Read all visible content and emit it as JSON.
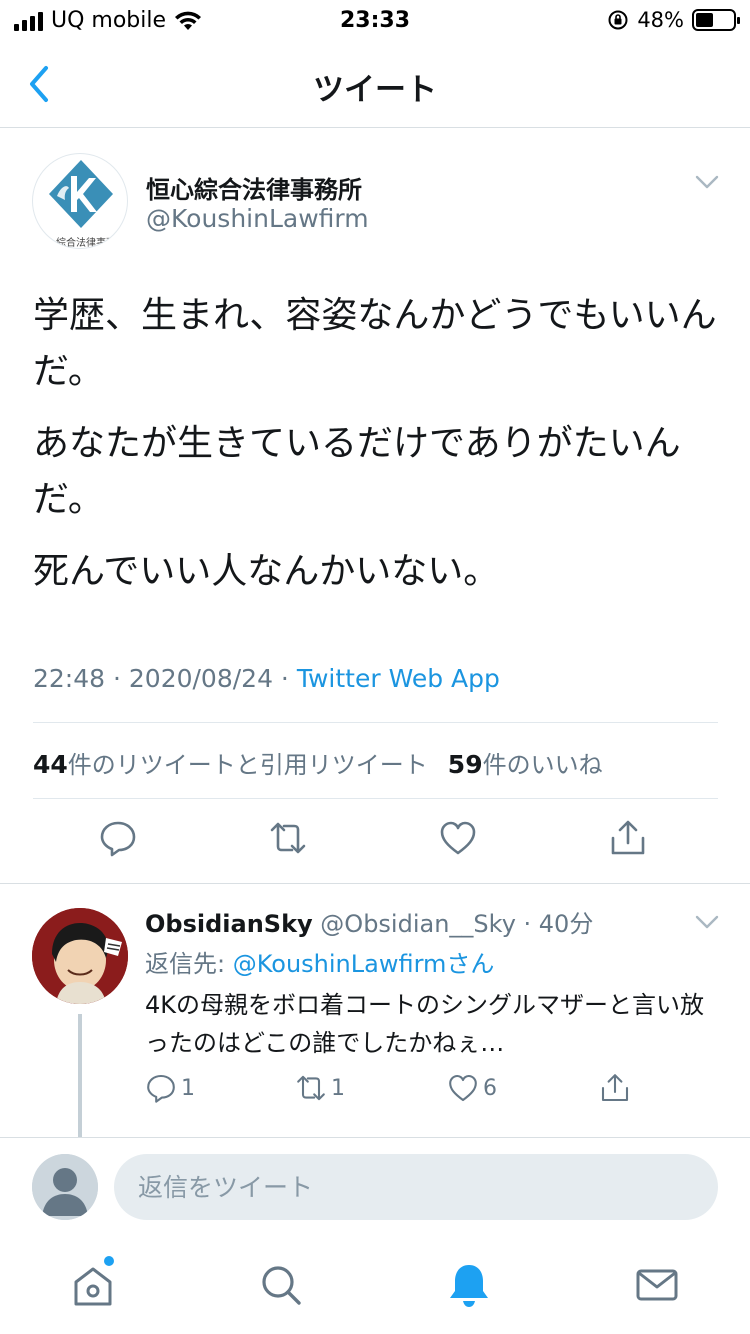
{
  "status_bar": {
    "carrier": "UQ mobile",
    "time": "23:33",
    "battery": "48%",
    "battery_level": 0.48
  },
  "nav": {
    "title": "ツイート"
  },
  "tweet": {
    "author_name": "恒心綜合法律事務所",
    "author_handle": "@KoushinLawfirm",
    "avatar_caption": "恒心綜合法律事務所",
    "paragraphs": [
      "学歴、生まれ、容姿なんかどうでもいいんだ。",
      "あなたが生きているだけでありがたいんだ。",
      "死んでいい人なんかいない。"
    ],
    "timestamp": "22:48 · 2020/08/24 · ",
    "source": "Twitter Web App",
    "retweet_count": "44",
    "retweet_label": "件のリツイートと引用リツイート",
    "like_count": "59",
    "like_label": "件のいいね"
  },
  "reply": {
    "name": "ObsidianSky",
    "meta": " @Obsidian__Sky · 40分",
    "reply_to_prefix": "返信先: ",
    "reply_to_mention": "@KoushinLawfirmさん",
    "text": "4Kの母親をボロ着コートのシングルマザーと言い放ったのはどこの誰でしたかねぇ…",
    "reply_count": "1",
    "retweet_count": "1",
    "like_count": "6"
  },
  "composer": {
    "placeholder": "返信をツイート"
  },
  "colors": {
    "accent": "#1da1f2",
    "link": "#1b95e0",
    "secondary_text": "#657786",
    "divider": "#e1e8ed"
  },
  "icons": {
    "back": "chevron-left-icon",
    "caret": "chevron-down-icon",
    "reply": "comment-icon",
    "retweet": "retweet-icon",
    "like": "heart-icon",
    "share": "share-icon",
    "home": "home-icon",
    "search": "search-icon",
    "notifications": "bell-icon",
    "messages": "envelope-icon"
  }
}
